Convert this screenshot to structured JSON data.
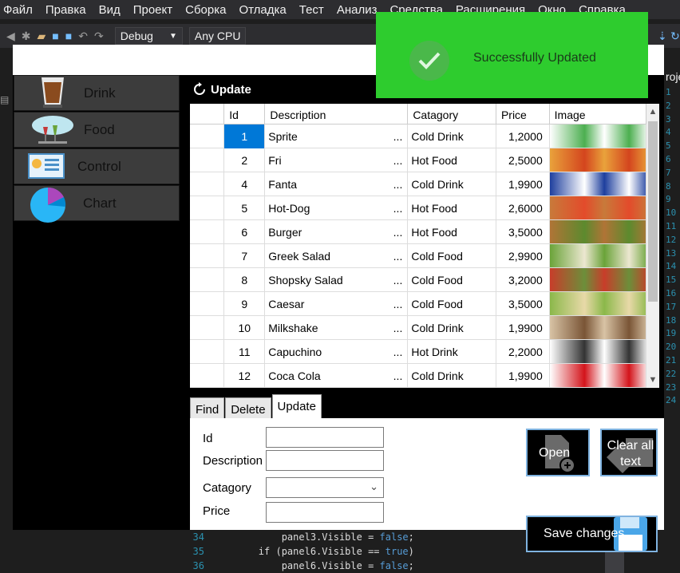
{
  "vs": {
    "menu": [
      "Файл",
      "Правка",
      "Вид",
      "Проект",
      "Сборка",
      "Отладка",
      "Тест",
      "Анализ",
      "Средства",
      "Расширения",
      "Окно",
      "Справка"
    ],
    "config": "Debug",
    "platform": "Any CPU",
    "right_label": "roje",
    "line_numbers": [
      "1",
      "2",
      "3",
      "4",
      "5",
      "6",
      "7",
      "8",
      "9",
      "10",
      "11",
      "12",
      "13",
      "14",
      "15",
      "16",
      "17",
      "18",
      "19",
      "20",
      "21",
      "22",
      "23",
      "24"
    ],
    "code_lines": [
      {
        "num": "34",
        "code": "            panel3.Visible = ",
        "kw": "false",
        "end": ";"
      },
      {
        "num": "35",
        "code": "        if (panel6.Visible == ",
        "kw": "true",
        "end": ")"
      },
      {
        "num": "36",
        "code": "            panel6.Visible = ",
        "kw": "false",
        "end": ";"
      }
    ]
  },
  "nav": {
    "items": [
      {
        "label": "Drink",
        "icon": "coffee-cup-icon"
      },
      {
        "label": "Food",
        "icon": "food-icon"
      },
      {
        "label": "Control",
        "icon": "control-panel-icon"
      },
      {
        "label": "Chart",
        "icon": "pie-chart-icon"
      }
    ]
  },
  "content": {
    "title": "Update"
  },
  "grid": {
    "columns": [
      "Id",
      "Description",
      "Catagory",
      "Price",
      "Image"
    ],
    "rows": [
      {
        "id": "1",
        "desc": "Sprite",
        "cat": "Cold Drink",
        "price": "1,2000",
        "selected": true,
        "colors": [
          "#ffffff",
          "#4caf50"
        ]
      },
      {
        "id": "2",
        "desc": "Fri",
        "cat": "Hot Food",
        "price": "2,5000",
        "colors": [
          "#e9a23b",
          "#d4451e"
        ]
      },
      {
        "id": "4",
        "desc": "Fanta",
        "cat": "Cold Drink",
        "price": "1,9900",
        "colors": [
          "#1e3f9e",
          "#ffffff"
        ]
      },
      {
        "id": "5",
        "desc": "Hot-Dog",
        "cat": "Hot Food",
        "price": "2,6000",
        "colors": [
          "#c87a3a",
          "#e34b2b"
        ]
      },
      {
        "id": "6",
        "desc": "Burger",
        "cat": "Hot Food",
        "price": "3,5000",
        "colors": [
          "#b07436",
          "#5c8a2e"
        ]
      },
      {
        "id": "7",
        "desc": "Greek Salad",
        "cat": "Cold Food",
        "price": "2,9900",
        "colors": [
          "#6aa339",
          "#ece7d0"
        ]
      },
      {
        "id": "8",
        "desc": "Shopsky Salad",
        "cat": "Cold Food",
        "price": "3,2000",
        "colors": [
          "#c83d2a",
          "#6c8f3a"
        ]
      },
      {
        "id": "9",
        "desc": "Caesar",
        "cat": "Cold Food",
        "price": "3,5000",
        "colors": [
          "#8bb84a",
          "#e8d9a8"
        ]
      },
      {
        "id": "10",
        "desc": "Milkshake",
        "cat": "Cold Drink",
        "price": "1,9900",
        "colors": [
          "#d8c3a5",
          "#7a5536"
        ]
      },
      {
        "id": "11",
        "desc": "Capuchino",
        "cat": "Hot Drink",
        "price": "2,2000",
        "colors": [
          "#ffffff",
          "#333333"
        ]
      },
      {
        "id": "12",
        "desc": "Coca Cola",
        "cat": "Cold Drink",
        "price": "1,9900",
        "colors": [
          "#ffffff",
          "#d3141b"
        ]
      }
    ]
  },
  "tabs": [
    "Find",
    "Delete",
    "Update"
  ],
  "form": {
    "labels": {
      "id": "Id",
      "description": "Description",
      "category": "Catagory",
      "price": "Price"
    },
    "values": {
      "id": "",
      "description": "",
      "category": "",
      "price": ""
    }
  },
  "buttons": {
    "open": "Open",
    "clear": "Clear all text",
    "save": "Save changes"
  },
  "toast": {
    "message": "Successfully Updated",
    "color": "#2ecc2e"
  }
}
